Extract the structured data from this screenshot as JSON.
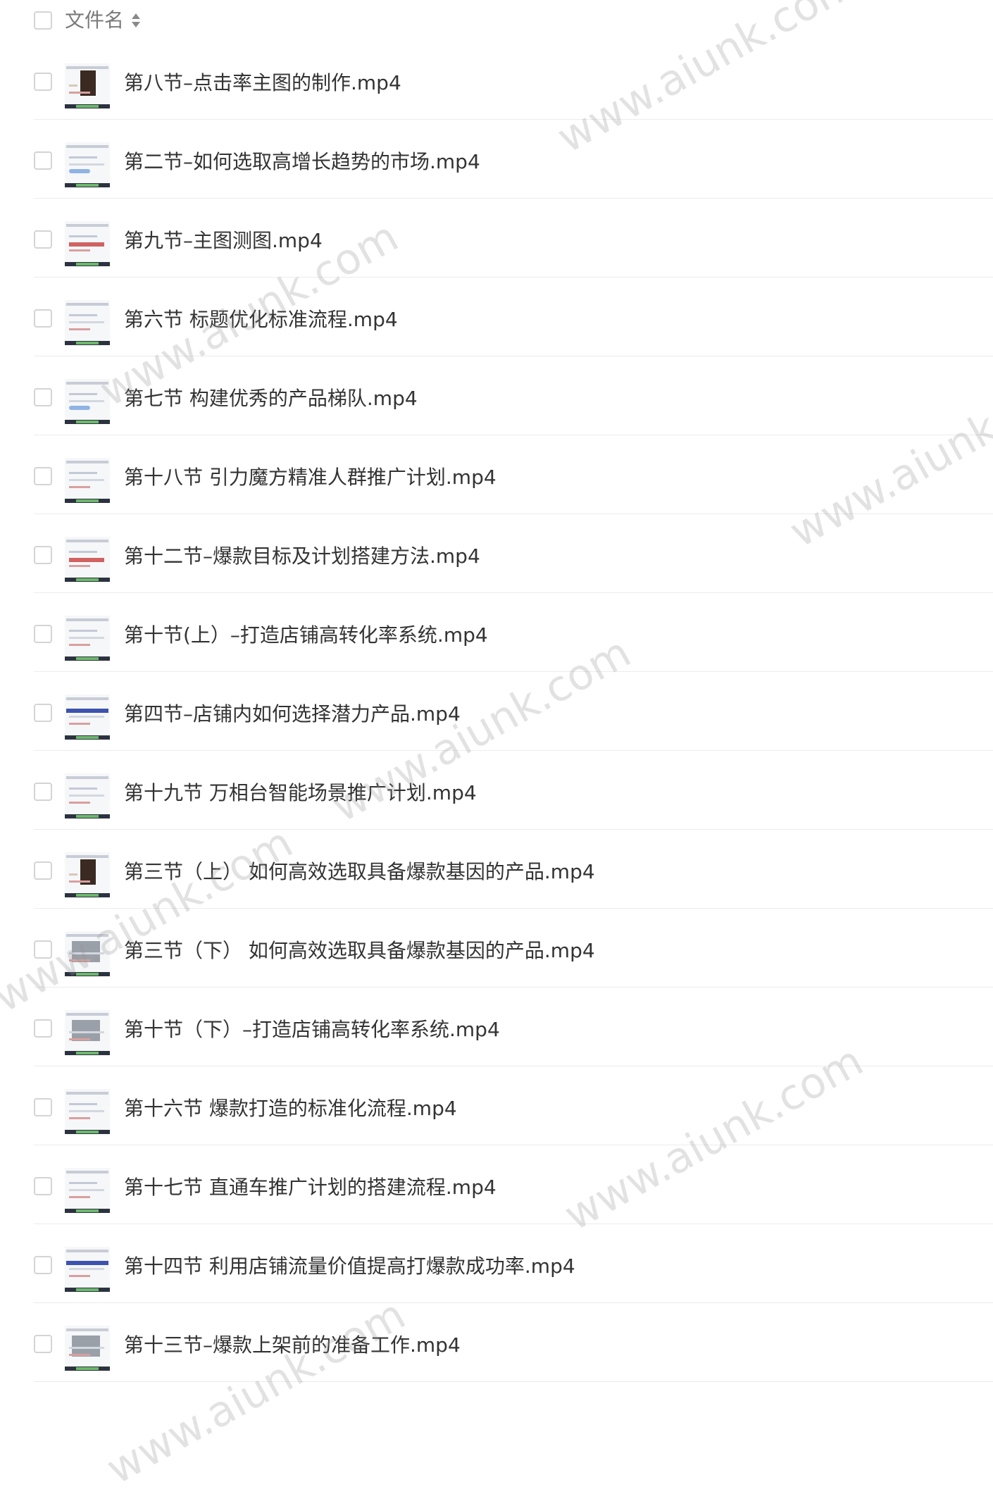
{
  "header": {
    "label": "文件名"
  },
  "files": [
    {
      "name": "第八节–点击率主图的制作.mp4",
      "thumb": "dark"
    },
    {
      "name": "第二节–如何选取高增长趋势的市场.mp4",
      "thumb": "graph"
    },
    {
      "name": "第九节–主图测图.mp4",
      "thumb": "red"
    },
    {
      "name": "第六节 标题优化标准流程.mp4",
      "thumb": "plain"
    },
    {
      "name": "第七节 构建优秀的产品梯队.mp4",
      "thumb": "graph"
    },
    {
      "name": "第十八节 引力魔方精准人群推广计划.mp4",
      "thumb": "plain"
    },
    {
      "name": "第十二节–爆款目标及计划搭建方法.mp4",
      "thumb": "red"
    },
    {
      "name": "第十节(上）–打造店铺高转化率系统.mp4",
      "thumb": "plain"
    },
    {
      "name": "第四节–店铺内如何选择潜力产品.mp4",
      "thumb": "blue"
    },
    {
      "name": "第十九节 万相台智能场景推广计划.mp4",
      "thumb": "plain"
    },
    {
      "name": "第三节（上） 如何高效选取具备爆款基因的产品.mp4",
      "thumb": "dark"
    },
    {
      "name": "第三节（下） 如何高效选取具备爆款基因的产品.mp4",
      "thumb": "image"
    },
    {
      "name": "第十节（下）–打造店铺高转化率系统.mp4",
      "thumb": "image"
    },
    {
      "name": "第十六节 爆款打造的标准化流程.mp4",
      "thumb": "plain"
    },
    {
      "name": "第十七节 直通车推广计划的搭建流程.mp4",
      "thumb": "plain"
    },
    {
      "name": "第十四节 利用店铺流量价值提高打爆款成功率.mp4",
      "thumb": "blue"
    },
    {
      "name": "第十三节–爆款上架前的准备工作.mp4",
      "thumb": "image"
    }
  ],
  "watermark": {
    "text": "www.aiunk.com"
  },
  "icons": {
    "sort": "sort-icon",
    "checkbox": "checkbox-icon",
    "thumbnail": "video-thumbnail"
  },
  "colors": {
    "text": "#333333",
    "header_text": "#7a7a7a",
    "divider": "#ececec",
    "checkbox_border": "#d4d4d4"
  }
}
